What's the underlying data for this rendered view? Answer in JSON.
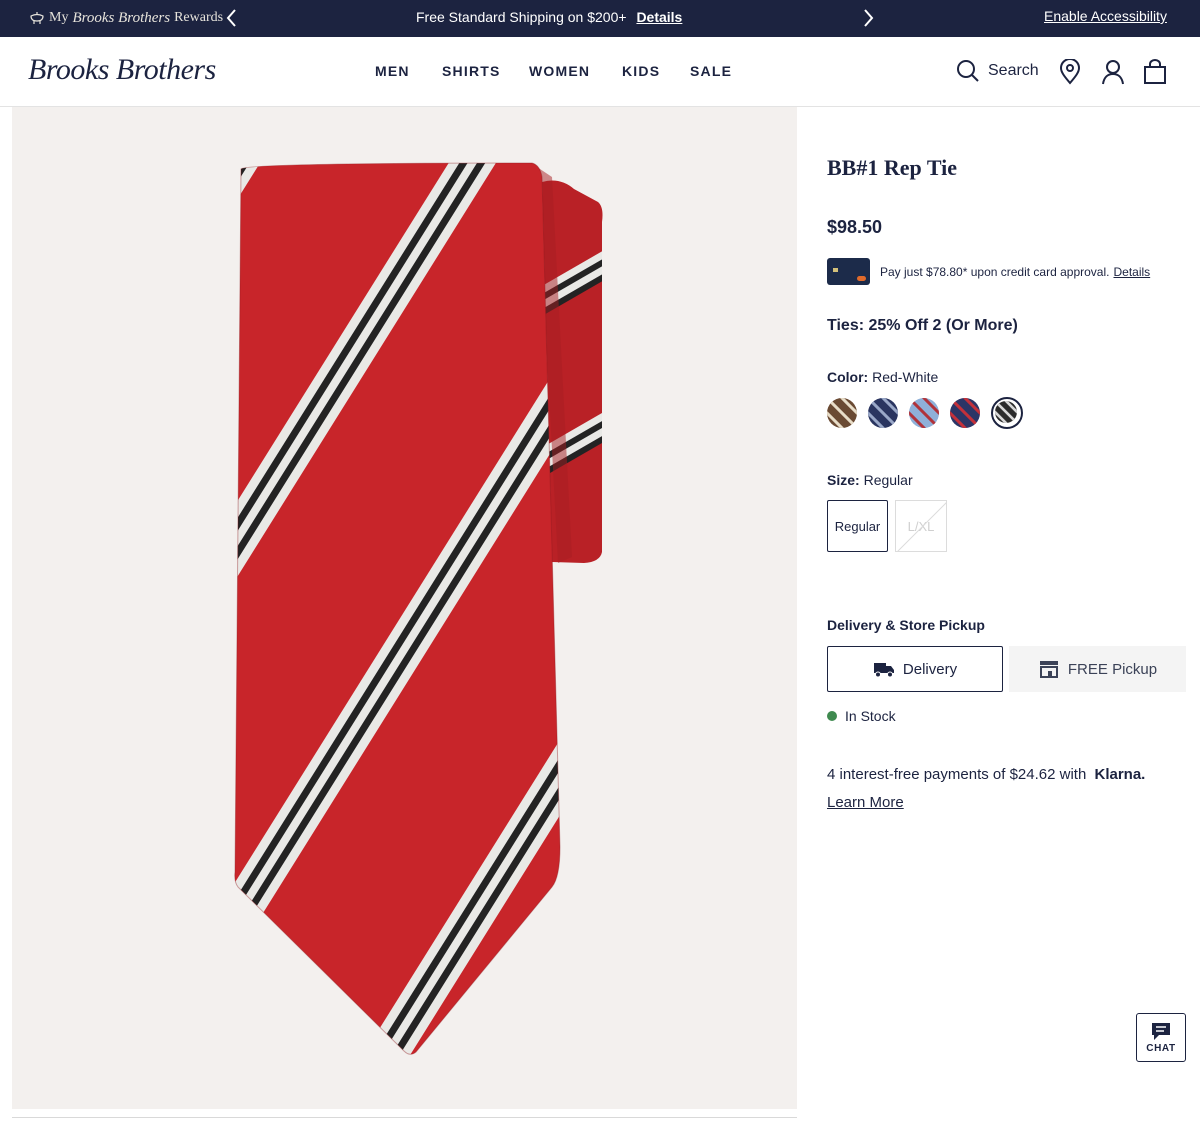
{
  "promo_bar": {
    "rewards_prefix": "My",
    "rewards_script": "Brooks Brothers",
    "rewards_suffix": "Rewards",
    "message": "Free Standard Shipping on $200+",
    "details_link": "Details",
    "accessibility_link": "Enable Accessibility"
  },
  "header": {
    "logo": "Brooks Brothers",
    "nav": [
      "MEN",
      "SHIRTS",
      "WOMEN",
      "KIDS",
      "SALE"
    ],
    "search_label": "Search"
  },
  "product": {
    "title": "BB#1 Rep Tie",
    "price": "$98.50",
    "card_offer": "Pay just $78.80* upon credit card approval.",
    "card_details": "Details",
    "promo": "Ties: 25% Off 2 (Or More)",
    "color_key": "Color:",
    "color_value": "Red-White",
    "swatches": [
      {
        "name": "brown-stripe",
        "base": "#6a4a33",
        "stripe": "#e8ddc8"
      },
      {
        "name": "navy-stripe",
        "base": "#2a3560",
        "stripe": "#9aa8c8"
      },
      {
        "name": "blue-red-stripe",
        "base": "#8fb0d8",
        "stripe": "#b0333a"
      },
      {
        "name": "navy-red-stripe",
        "base": "#2c3566",
        "stripe": "#c4303a"
      },
      {
        "name": "red-white-stripe",
        "base": "#2b2b2b",
        "stripe": "#d8d8d8"
      }
    ],
    "size_key": "Size:",
    "size_value": "Regular",
    "sizes": [
      "Regular",
      "L/XL"
    ],
    "delivery_heading": "Delivery & Store Pickup",
    "delivery_option": "Delivery",
    "pickup_option": "FREE Pickup",
    "stock_status": "In Stock",
    "klarna_text": "4 interest-free payments of $24.62 with",
    "klarna_brand": "Klarna.",
    "learn_more": "Learn More"
  },
  "chat": {
    "label": "CHAT"
  },
  "colors": {
    "navy": "#1c2340",
    "tie_red": "#c8252a",
    "stock_green": "#3f8a4f",
    "image_bg": "#f3f0ee"
  }
}
